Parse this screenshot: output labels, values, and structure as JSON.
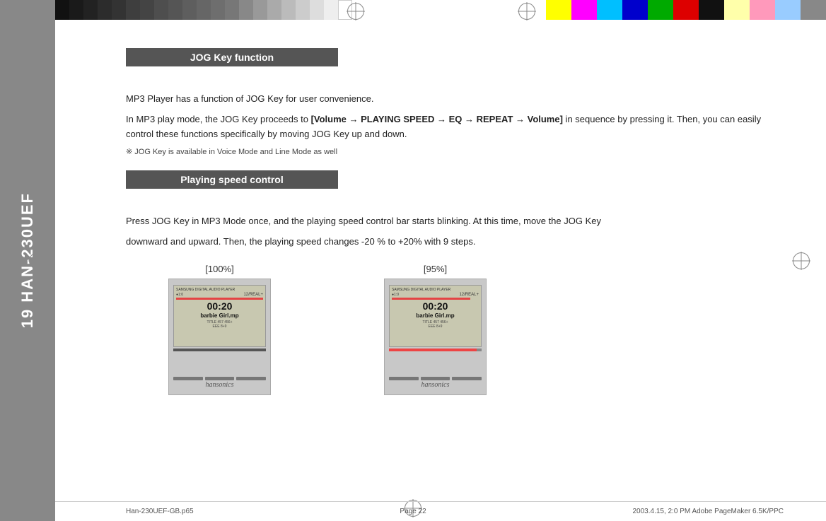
{
  "colorBarsLeft": {
    "blacks": [
      "#111",
      "#222",
      "#1a1a1a",
      "#2a2a2a",
      "#333",
      "#444",
      "#3a3a3a",
      "#4a4a4a",
      "#555",
      "#5a5a5a",
      "#666",
      "#777",
      "#888",
      "#999",
      "#aaa",
      "#bbb",
      "#ccc",
      "#ddd",
      "#eee",
      "#fff"
    ],
    "grays": [
      "#888",
      "#999",
      "#aaa",
      "#bbb",
      "#ccc",
      "#ddd",
      "#eee",
      "#fff"
    ]
  },
  "colorBarsRight": {
    "swatches": [
      "#FFFF00",
      "#FF00FF",
      "#00BFFF",
      "#0000FF",
      "#00AA00",
      "#FF0000",
      "#111111",
      "#FFFF88",
      "#FF88AA",
      "#88CCFF",
      "#888888"
    ]
  },
  "sidebar": {
    "text": "19 HAN-230UEF"
  },
  "page": {
    "section1": {
      "header": "JOG Key function",
      "paragraph1": "MP3 Player has a function of JOG Key for user convenience.",
      "paragraph2_pre": "In MP3 play mode, the JOG Key proceeds to ",
      "paragraph2_bold": "[Volume → PLAYING SPEED → EQ →  REPEAT → Volume]",
      "paragraph2_post": " in sequence by pressing it. Then, you can easily control these functions specifically by moving JOG Key up and down.",
      "note": "※  JOG Key is available in Voice Mode and Line Mode as well"
    },
    "section2": {
      "header": "Playing speed control",
      "paragraph1": "Press JOG Key in MP3 Mode once, and the playing speed control bar starts blinking. At this time, move the JOG Key",
      "paragraph2": "downward and upward. Then, the playing speed changes -20 % to +20% with 9 steps."
    },
    "images": [
      {
        "label": "[100%]",
        "altText": "MP3 player display at 100% speed"
      },
      {
        "label": "[95%]",
        "altText": "MP3 player display at 95% speed"
      }
    ]
  },
  "footer": {
    "left": "Han-230UEF-GB.p65",
    "center": "Page 22",
    "right": "2003.4.15, 2:0 PM   Adobe PageMaker 6.5K/PPC"
  }
}
